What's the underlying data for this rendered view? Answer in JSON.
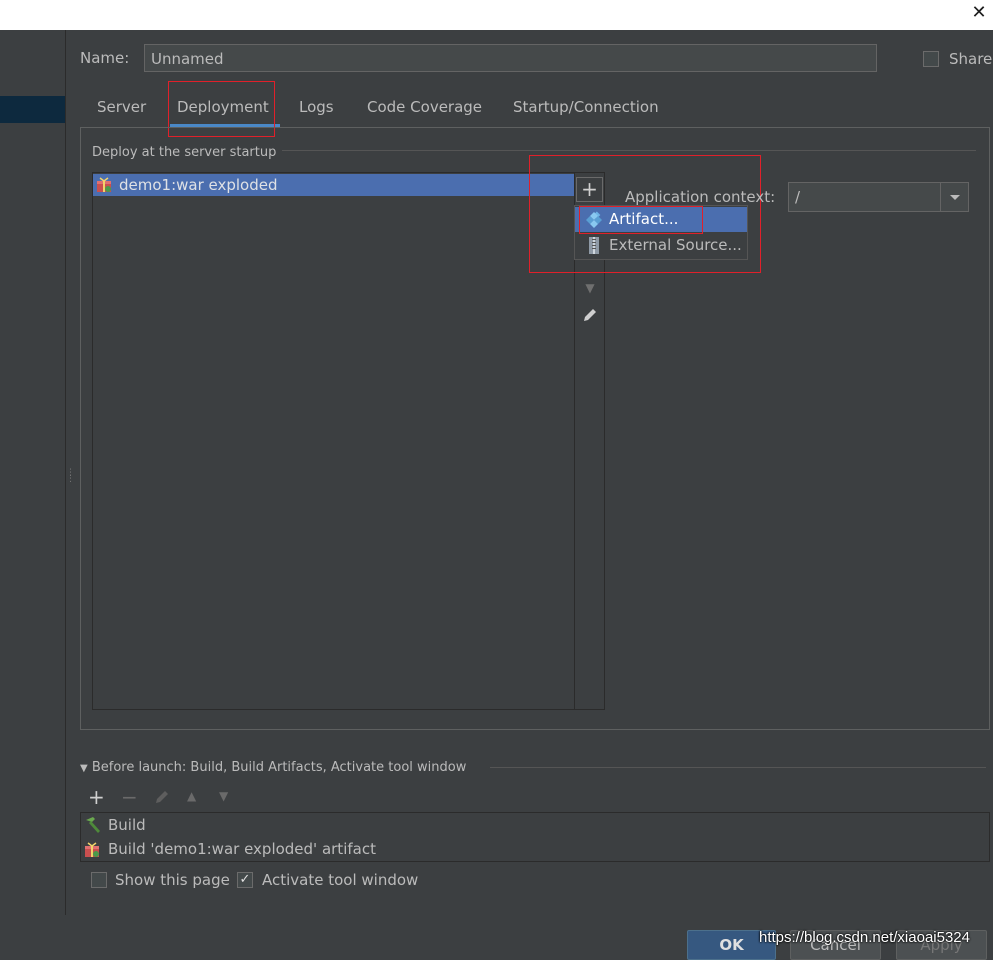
{
  "window": {
    "close_glyph": "✕"
  },
  "name": {
    "label": "Name:",
    "value": "Unnamed"
  },
  "share": {
    "label": "Share",
    "checked": false
  },
  "tabs": [
    {
      "label": "Server"
    },
    {
      "label": "Deployment",
      "active": true
    },
    {
      "label": "Logs"
    },
    {
      "label": "Code Coverage"
    },
    {
      "label": "Startup/Connection"
    }
  ],
  "deployment": {
    "section_title": "Deploy at the server startup",
    "items": [
      {
        "label": "demo1:war exploded",
        "icon": "artifact-icon"
      }
    ],
    "add_glyph": "+",
    "popup": [
      {
        "label": "Artifact...",
        "icon": "artifact-diamond-icon"
      },
      {
        "label": "External Source...",
        "icon": "archive-icon"
      }
    ],
    "context_label": "Application context:",
    "context_value": "/"
  },
  "before_launch": {
    "title": "Before launch: Build, Build Artifacts, Activate tool window",
    "items": [
      {
        "label": "Build",
        "icon": "hammer-icon"
      },
      {
        "label": "Build 'demo1:war exploded' artifact",
        "icon": "artifact-icon"
      }
    ]
  },
  "options": {
    "show_page": {
      "label": "Show this page",
      "checked": false
    },
    "activate_tool": {
      "label": "Activate tool window",
      "checked": true
    }
  },
  "buttons": {
    "ok": "OK",
    "cancel": "Cancel",
    "apply": "Apply"
  },
  "watermark": "https://blog.csdn.net/xiaoai5324"
}
